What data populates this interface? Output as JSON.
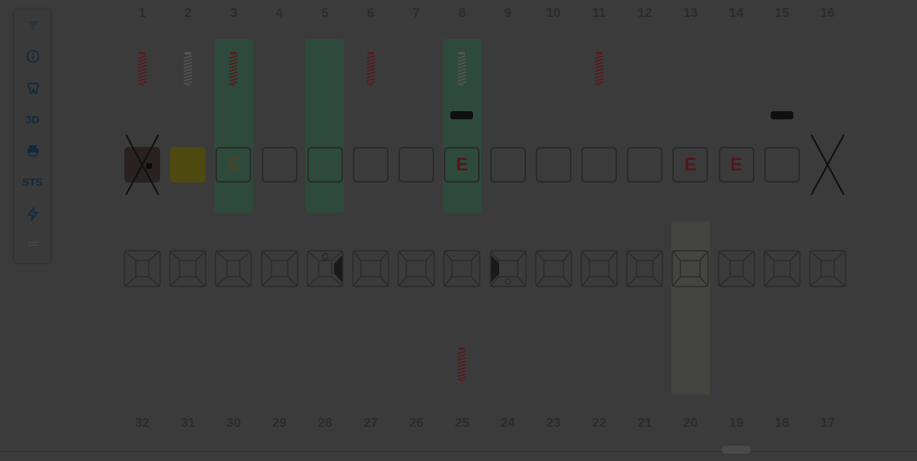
{
  "toolbar": {
    "items": [
      {
        "name": "filter-icon",
        "icon": "filter",
        "label": ""
      },
      {
        "name": "info-icon",
        "icon": "info",
        "label": ""
      },
      {
        "name": "tooth-icon",
        "icon": "tooth",
        "label": ""
      },
      {
        "name": "view-3d-button",
        "icon": "text",
        "label": "3D"
      },
      {
        "name": "print-icon",
        "icon": "print",
        "label": ""
      },
      {
        "name": "sts-button",
        "icon": "text",
        "label": "STS"
      },
      {
        "name": "lightning-icon",
        "icon": "bolt",
        "label": ""
      },
      {
        "name": "collapse-icon",
        "icon": "lines",
        "label": ""
      }
    ]
  },
  "upper_numbers": [
    "1",
    "2",
    "3",
    "4",
    "5",
    "6",
    "7",
    "8",
    "9",
    "10",
    "11",
    "12",
    "13",
    "14",
    "15",
    "16"
  ],
  "lower_numbers": [
    "32",
    "31",
    "30",
    "29",
    "28",
    "27",
    "26",
    "25",
    "24",
    "23",
    "22",
    "21",
    "20",
    "19",
    "18",
    "17"
  ],
  "upper_teeth": [
    {
      "box": "dark-marker",
      "label": "",
      "implant": "red",
      "crossed": true,
      "highlight": false,
      "bridge": false
    },
    {
      "box": "yellow",
      "label": "",
      "implant": "grey",
      "crossed": false,
      "highlight": false,
      "bridge": false
    },
    {
      "box": "outline",
      "label": "E",
      "implant": "red",
      "crossed": false,
      "highlight": true,
      "bridge": false
    },
    {
      "box": "outline",
      "label": "",
      "implant": "",
      "crossed": false,
      "highlight": false,
      "bridge": false
    },
    {
      "box": "outline",
      "label": "",
      "implant": "",
      "crossed": false,
      "highlight": true,
      "bridge": false
    },
    {
      "box": "outline",
      "label": "",
      "implant": "red",
      "crossed": false,
      "highlight": false,
      "bridge": false
    },
    {
      "box": "outline",
      "label": "",
      "implant": "",
      "crossed": false,
      "highlight": false,
      "bridge": false
    },
    {
      "box": "outline",
      "label": "E",
      "implant": "grey",
      "crossed": false,
      "highlight": true,
      "bridge": true
    },
    {
      "box": "outline",
      "label": "",
      "implant": "",
      "crossed": false,
      "highlight": false,
      "bridge": false
    },
    {
      "box": "outline",
      "label": "",
      "implant": "",
      "crossed": false,
      "highlight": false,
      "bridge": false
    },
    {
      "box": "outline",
      "label": "",
      "implant": "red",
      "crossed": false,
      "highlight": false,
      "bridge": false
    },
    {
      "box": "outline",
      "label": "",
      "implant": "",
      "crossed": false,
      "highlight": false,
      "bridge": false
    },
    {
      "box": "outline",
      "label": "E",
      "implant": "",
      "crossed": false,
      "highlight": false,
      "bridge": false
    },
    {
      "box": "outline",
      "label": "E",
      "implant": "",
      "crossed": false,
      "highlight": false,
      "bridge": false
    },
    {
      "box": "outline",
      "label": "",
      "implant": "",
      "crossed": false,
      "highlight": false,
      "bridge": true
    },
    {
      "box": "none",
      "label": "",
      "implant": "",
      "crossed": true,
      "highlight": false,
      "bridge": false
    }
  ],
  "lower_teeth": [
    {
      "style": "narrow",
      "implant": "",
      "highlight": false,
      "mark": ""
    },
    {
      "style": "normal",
      "implant": "",
      "highlight": false,
      "mark": ""
    },
    {
      "style": "narrow",
      "implant": "",
      "highlight": false,
      "mark": ""
    },
    {
      "style": "normal",
      "implant": "",
      "highlight": false,
      "mark": ""
    },
    {
      "style": "narrow",
      "implant": "",
      "highlight": false,
      "mark": "right"
    },
    {
      "style": "wide",
      "implant": "",
      "highlight": false,
      "mark": ""
    },
    {
      "style": "wide",
      "implant": "",
      "highlight": false,
      "mark": ""
    },
    {
      "style": "wide",
      "implant": "red",
      "highlight": false,
      "mark": ""
    },
    {
      "style": "wide",
      "implant": "",
      "highlight": false,
      "mark": "left"
    },
    {
      "style": "wide",
      "implant": "",
      "highlight": false,
      "mark": ""
    },
    {
      "style": "wide",
      "implant": "",
      "highlight": false,
      "mark": ""
    },
    {
      "style": "normal",
      "implant": "",
      "highlight": false,
      "mark": ""
    },
    {
      "style": "wide",
      "implant": "",
      "highlight": true,
      "mark": ""
    },
    {
      "style": "narrow",
      "implant": "",
      "highlight": false,
      "mark": ""
    },
    {
      "style": "normal",
      "implant": "",
      "highlight": false,
      "mark": ""
    },
    {
      "style": "narrow",
      "implant": "",
      "highlight": false,
      "mark": ""
    }
  ],
  "colors": {
    "implant_red": "#5a1a1c",
    "implant_grey": "#555555",
    "highlight_green": "#2d4a3d",
    "highlight_lower": "#444440",
    "yellow_fill": "#4e4811",
    "dark_fill": "#2a2222",
    "box_border": "#2b2b2b",
    "label_e": "#55151a"
  }
}
